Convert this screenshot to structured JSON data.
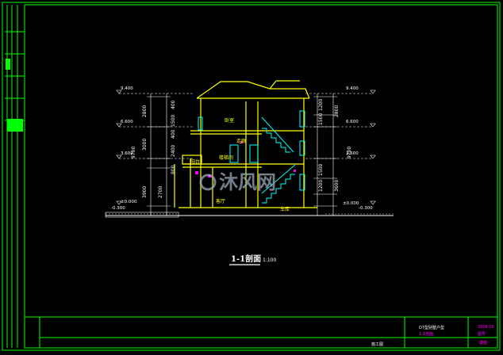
{
  "colors": {
    "background": "#000000",
    "frame": "#00ff00",
    "structure": "#ffff00",
    "dimension": "#ffffff",
    "accent": "#ff00ff",
    "stairs": "#00ffff",
    "watermark": "#9aa8b8"
  },
  "drawing": {
    "title": "1-1剖面",
    "scale": "1:100",
    "levels": {
      "roof": "9.400",
      "second": "6.600",
      "first": "3.600",
      "ground": "±0.000",
      "outside_left": "-0.300",
      "outside_right": "-0.300"
    },
    "left_dims": [
      "2800",
      "3000",
      "3900",
      "2700",
      "9700"
    ],
    "right_dims": [
      "1200",
      "1500",
      "1500",
      "1200",
      "2800",
      "3600",
      "9700"
    ],
    "center_dims": [
      "400",
      "1500",
      "400",
      "2400",
      "800"
    ],
    "room_labels": [
      "卧室",
      "走廊",
      "楼梯间",
      "客厅",
      "车库",
      "阳台"
    ]
  },
  "watermark": "沐风网",
  "titleblock": {
    "project": "D7型别墅户型",
    "sheet": "1-1剖面",
    "date": "2008.05",
    "stage": "施工图",
    "sheet_no_label": "图号",
    "sheet_no": "建施"
  }
}
